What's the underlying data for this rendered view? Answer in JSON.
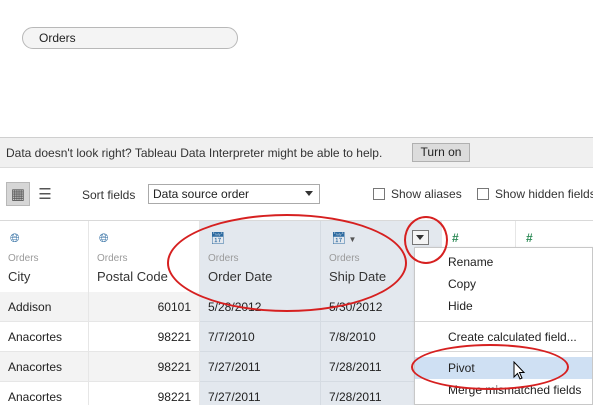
{
  "connection": {
    "table_pill": "Orders"
  },
  "interpreter": {
    "message": "Data doesn't look right? Tableau Data Interpreter might be able to help.",
    "button": "Turn on"
  },
  "toolbar": {
    "grid_view_icon": "grid-icon",
    "list_view_icon": "list-icon",
    "sort_label": "Sort fields",
    "sort_value": "Data source order",
    "show_aliases": "Show aliases",
    "show_hidden": "Show hidden fields"
  },
  "columns": [
    {
      "icon": "globe-icon",
      "source": "Orders",
      "name": "City"
    },
    {
      "icon": "globe-icon",
      "source": "Orders",
      "name": "Postal Code"
    },
    {
      "icon": "calendar-icon",
      "source": "Orders",
      "name": "Order Date"
    },
    {
      "icon": "calendar-icon",
      "source": "Orders",
      "name": "Ship Date"
    },
    {
      "icon": "number-icon",
      "source": "",
      "name": ""
    },
    {
      "icon": "number-icon",
      "source": "",
      "name": ""
    }
  ],
  "rows": [
    {
      "city": "Addison",
      "postal": "60101",
      "order_date": "5/28/2012",
      "ship_date": "5/30/2012"
    },
    {
      "city": "Anacortes",
      "postal": "98221",
      "order_date": "7/7/2010",
      "ship_date": "7/8/2010"
    },
    {
      "city": "Anacortes",
      "postal": "98221",
      "order_date": "7/27/2011",
      "ship_date": "7/28/2011"
    },
    {
      "city": "Anacortes",
      "postal": "98221",
      "order_date": "7/27/2011",
      "ship_date": "7/28/2011"
    }
  ],
  "context_menu": {
    "items": [
      "Rename",
      "Copy",
      "Hide",
      "Create calculated field...",
      "Pivot",
      "Merge mismatched fields"
    ],
    "highlighted": "Pivot"
  },
  "colors": {
    "annotation_ring": "#d62020",
    "selected_column": "#e3e8ee",
    "menu_highlight": "#cfe0f3",
    "field_icon": "#2c6aa0",
    "number_icon": "#2e8b57"
  }
}
